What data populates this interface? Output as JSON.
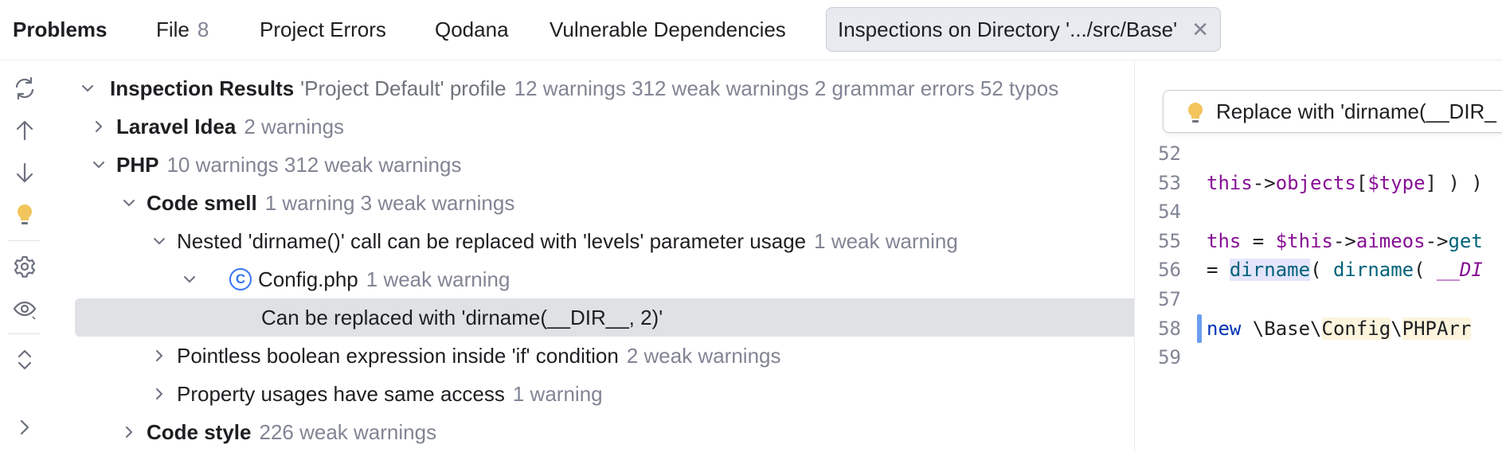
{
  "tabs": {
    "title": "Problems",
    "items": [
      {
        "label": "File",
        "count": "8"
      },
      {
        "label": "Project Errors"
      },
      {
        "label": "Qodana"
      },
      {
        "label": "Vulnerable Dependencies"
      },
      {
        "label": "Inspections on Directory '.../src/Base'",
        "active": true
      }
    ]
  },
  "toolbar": {
    "icons": [
      "rerun-icon",
      "arrow-up-icon",
      "arrow-down-icon",
      "bulb-icon",
      "gear-icon",
      "eye-icon",
      "expand-collapse-icon",
      "chevron-right-icon"
    ]
  },
  "tree": {
    "root": {
      "label": "Inspection Results",
      "profile": "'Project Default' profile",
      "summary": "12 warnings 312 weak warnings 2 grammar errors 52 typos"
    },
    "laravel": {
      "label": "Laravel Idea",
      "summary": "2 warnings"
    },
    "php": {
      "label": "PHP",
      "summary": "10 warnings 312 weak warnings"
    },
    "code_smell": {
      "label": "Code smell",
      "summary": "1 warning 3 weak warnings"
    },
    "nested": {
      "label": "Nested 'dirname()' call can be replaced with 'levels' parameter usage",
      "summary": "1 weak warning"
    },
    "config": {
      "label": "Config.php",
      "summary": "1 weak warning",
      "icon_letter": "C"
    },
    "problem": {
      "label": "Can be replaced with 'dirname(__DIR__, 2)'"
    },
    "pointless": {
      "label": "Pointless boolean expression inside 'if' condition",
      "summary": "2 weak warnings"
    },
    "property": {
      "label": "Property usages have same access",
      "summary": "1 warning"
    },
    "code_style": {
      "label": "Code style",
      "summary": "226 weak warnings"
    }
  },
  "editor": {
    "intention_label": "Replace with 'dirname(__DIR_",
    "lines": [
      {
        "n": "52"
      },
      {
        "n": "53",
        "tokens": [
          [
            "c-var",
            "this"
          ],
          [
            "c-plain",
            "->"
          ],
          [
            "c-var",
            "objects"
          ],
          [
            "c-plain",
            "["
          ],
          [
            "c-var",
            "$type"
          ],
          [
            "c-plain",
            "] ) )"
          ]
        ]
      },
      {
        "n": "54"
      },
      {
        "n": "55",
        "tokens": [
          [
            "c-var",
            "ths"
          ],
          [
            "c-plain",
            " = "
          ],
          [
            "c-var",
            "$this"
          ],
          [
            "c-plain",
            "->"
          ],
          [
            "c-var",
            "aimeos"
          ],
          [
            "c-plain",
            "->"
          ],
          [
            "c-fn",
            "get"
          ]
        ]
      },
      {
        "n": "56",
        "tokens": [
          [
            "c-plain",
            "= "
          ],
          [
            "c-fn c-hl",
            "dirname"
          ],
          [
            "c-plain",
            "( "
          ],
          [
            "c-fn",
            "dirname"
          ],
          [
            "c-plain",
            "( "
          ],
          [
            "c-const",
            "__DI"
          ]
        ]
      },
      {
        "n": "57"
      },
      {
        "n": "58",
        "tokens": [
          [
            "c-kw",
            " new "
          ],
          [
            "c-ns",
            "\\Base\\"
          ],
          [
            "c-ns c-cls",
            "Config"
          ],
          [
            "c-ns",
            "\\"
          ],
          [
            "c-ns c-cls",
            "PHPArr"
          ]
        ]
      },
      {
        "n": "59"
      }
    ]
  }
}
